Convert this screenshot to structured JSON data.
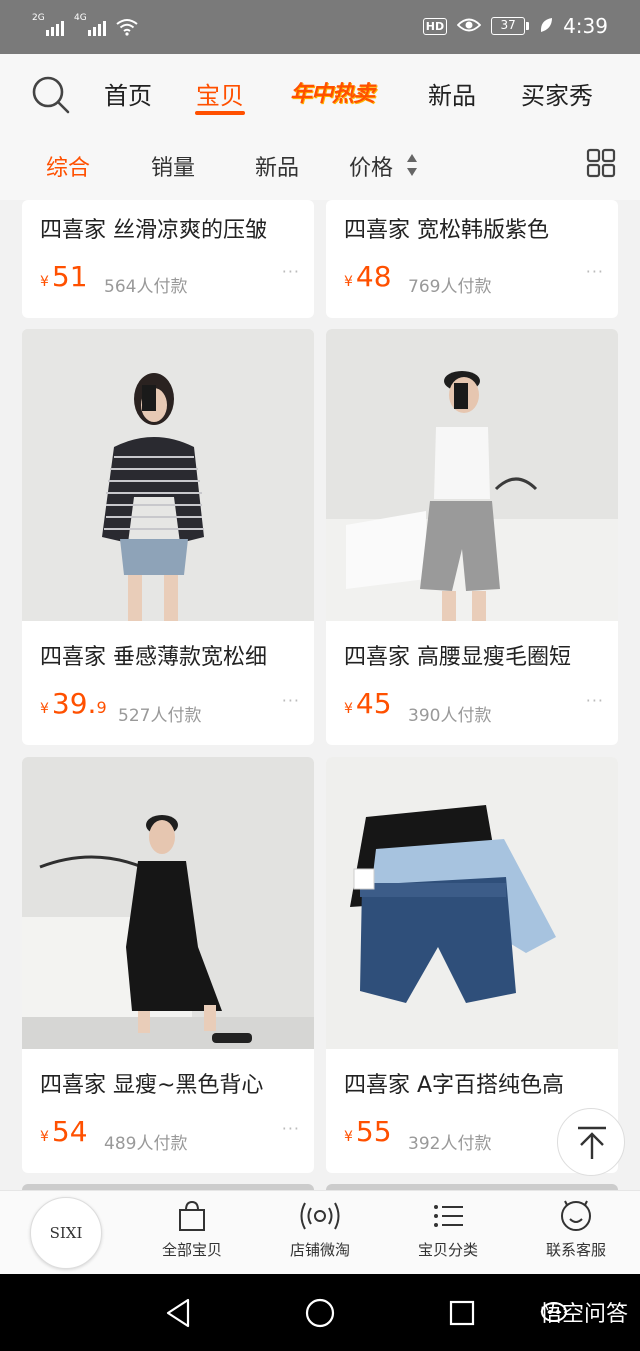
{
  "status_bar": {
    "sim1_net": "2G",
    "sim2_net": "4G",
    "hd": "HD",
    "battery": "37",
    "time": "4:39"
  },
  "nav": {
    "tabs": [
      "首页",
      "宝贝",
      "年中热卖",
      "新品",
      "买家秀"
    ],
    "active_tab": "宝贝",
    "accent_color": "#ff5000"
  },
  "sort": {
    "items": [
      "综合",
      "销量",
      "新品",
      "价格"
    ],
    "active": "综合"
  },
  "products": [
    {
      "title": "四喜家 丝滑凉爽的压皱",
      "currency": "¥",
      "price": "51",
      "decimal": "",
      "sold": "564人付款",
      "more": "···"
    },
    {
      "title": "四喜家  宽松韩版紫色",
      "currency": "¥",
      "price": "48",
      "decimal": "",
      "sold": "769人付款",
      "more": "···"
    },
    {
      "title": "四喜家 垂感薄款宽松细",
      "currency": "¥",
      "price": "39.",
      "decimal": "9",
      "sold": "527人付款",
      "more": "···"
    },
    {
      "title": "四喜家 高腰显瘦毛圈短",
      "currency": "¥",
      "price": "45",
      "decimal": "",
      "sold": "390人付款",
      "more": "···"
    },
    {
      "title": "四喜家 显瘦~黑色背心",
      "currency": "¥",
      "price": "54",
      "decimal": "",
      "sold": "489人付款",
      "more": "···"
    },
    {
      "title": "四喜家 A字百搭纯色高",
      "currency": "¥",
      "price": "55",
      "decimal": "",
      "sold": "392人付款",
      "more": "···"
    }
  ],
  "shop_bar": {
    "logo_text": "SIXI",
    "buttons": [
      "全部宝贝",
      "店铺微淘",
      "宝贝分类",
      "联系客服"
    ]
  },
  "watermark": "悟空问答"
}
